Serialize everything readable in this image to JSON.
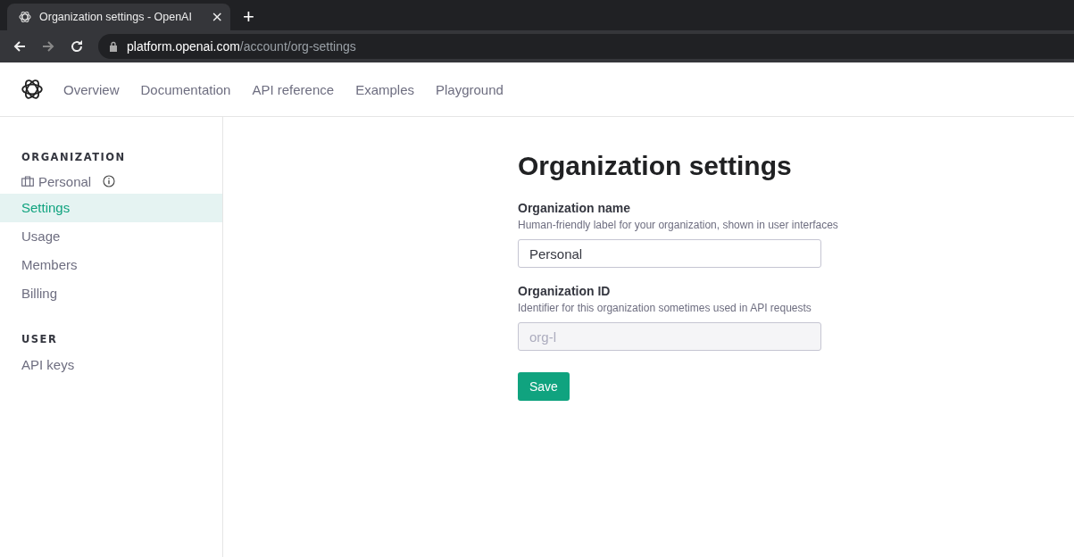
{
  "browser": {
    "tab_title": "Organization settings - OpenAI",
    "tab_close": "×",
    "new_tab": "+",
    "address_domain": "platform.openai.com",
    "address_path": "/account/org-settings"
  },
  "nav": {
    "items": [
      {
        "label": "Overview"
      },
      {
        "label": "Documentation"
      },
      {
        "label": "API reference"
      },
      {
        "label": "Examples"
      },
      {
        "label": "Playground"
      }
    ]
  },
  "sidebar": {
    "sections": [
      {
        "heading": "ORGANIZATION",
        "org_name": "Personal",
        "items": [
          {
            "label": "Settings",
            "selected": true
          },
          {
            "label": "Usage",
            "selected": false
          },
          {
            "label": "Members",
            "selected": false
          },
          {
            "label": "Billing",
            "selected": false
          }
        ]
      },
      {
        "heading": "USER",
        "items": [
          {
            "label": "API keys",
            "selected": false
          }
        ]
      }
    ]
  },
  "page": {
    "title": "Organization settings",
    "fields": [
      {
        "label": "Organization name",
        "description": "Human-friendly label for your organization, shown in user interfaces",
        "value": "Personal",
        "disabled": false
      },
      {
        "label": "Organization ID",
        "description": "Identifier for this organization sometimes used in API requests",
        "value": "org-l",
        "disabled": true
      }
    ],
    "button": "Save"
  }
}
